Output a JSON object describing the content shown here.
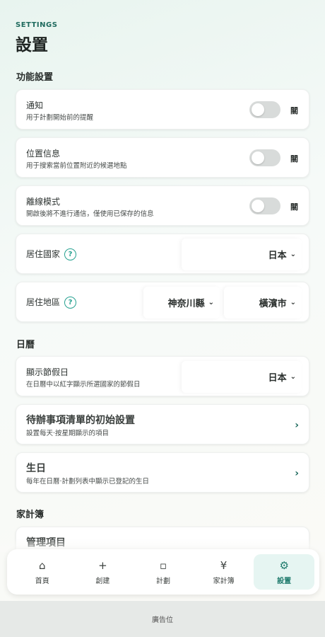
{
  "header": {
    "eyebrow": "SETTINGS",
    "title": "設置"
  },
  "sections": {
    "features": "功能設置",
    "calendar": "日曆",
    "budget": "家計簿"
  },
  "settings": {
    "notify": {
      "label": "通知",
      "sub": "用于計劃開始前的提醒",
      "state": "關",
      "on": false
    },
    "location": {
      "label": "位置信息",
      "sub": "用于搜索當前位置附近的候選地點",
      "state": "關",
      "on": false
    },
    "offline": {
      "label": "離線模式",
      "sub": "開啟後將不進行通信，僅使用已保存的信息",
      "state": "關",
      "on": false
    },
    "country": {
      "label": "居住國家",
      "help": "?",
      "value": "日本"
    },
    "region": {
      "label": "居住地區",
      "help": "?",
      "prefecture": "神奈川縣",
      "city": "橫濱市"
    },
    "holidays": {
      "label": "顯示節假日",
      "sub": "在日曆中以紅字顯示所選國家的節假日",
      "value": "日本"
    },
    "todo": {
      "label": "待辦事項清單的初始設置",
      "sub": "設置每天·按星期顯示的項目"
    },
    "birthday": {
      "label": "生日",
      "sub": "每年在日曆·計劃列表中顯示已登記的生日"
    },
    "manage": {
      "label": "管理項目"
    }
  },
  "nav": [
    {
      "icon": "⌂",
      "label": "首頁"
    },
    {
      "icon": "+",
      "label": "創建"
    },
    {
      "icon": "▫",
      "label": "計劃"
    },
    {
      "icon": "¥",
      "label": "家計簿"
    },
    {
      "icon": "⚙",
      "label": "設置"
    }
  ],
  "ad": "廣告位",
  "colors": {
    "accent": "#1f6a5e",
    "help": "#26a190",
    "active_bg": "#e6f5f2"
  }
}
